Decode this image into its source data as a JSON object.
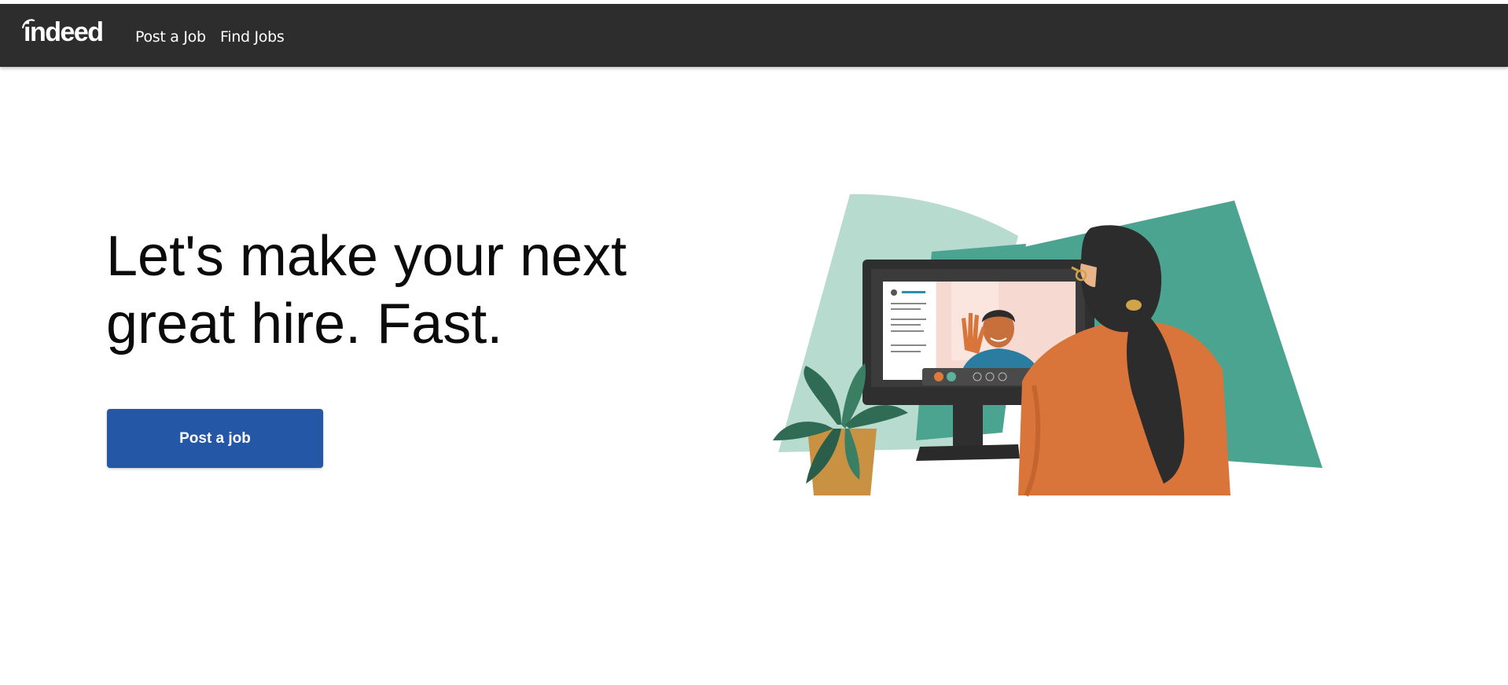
{
  "header": {
    "logo_text": "indeed",
    "nav": [
      {
        "label": "Post a Job"
      },
      {
        "label": "Find Jobs"
      }
    ]
  },
  "hero": {
    "title_line1": "Let's make your next",
    "title_line2": "great hire. Fast.",
    "cta_label": "Post a job"
  },
  "illustration": {
    "icon": "video-interview-illustration"
  },
  "colors": {
    "navbar": "#2d2d2d",
    "accent": "#2557a7",
    "teal_light": "#b8dbd0",
    "teal_dark": "#4ba48f",
    "orange": "#d9753a"
  }
}
